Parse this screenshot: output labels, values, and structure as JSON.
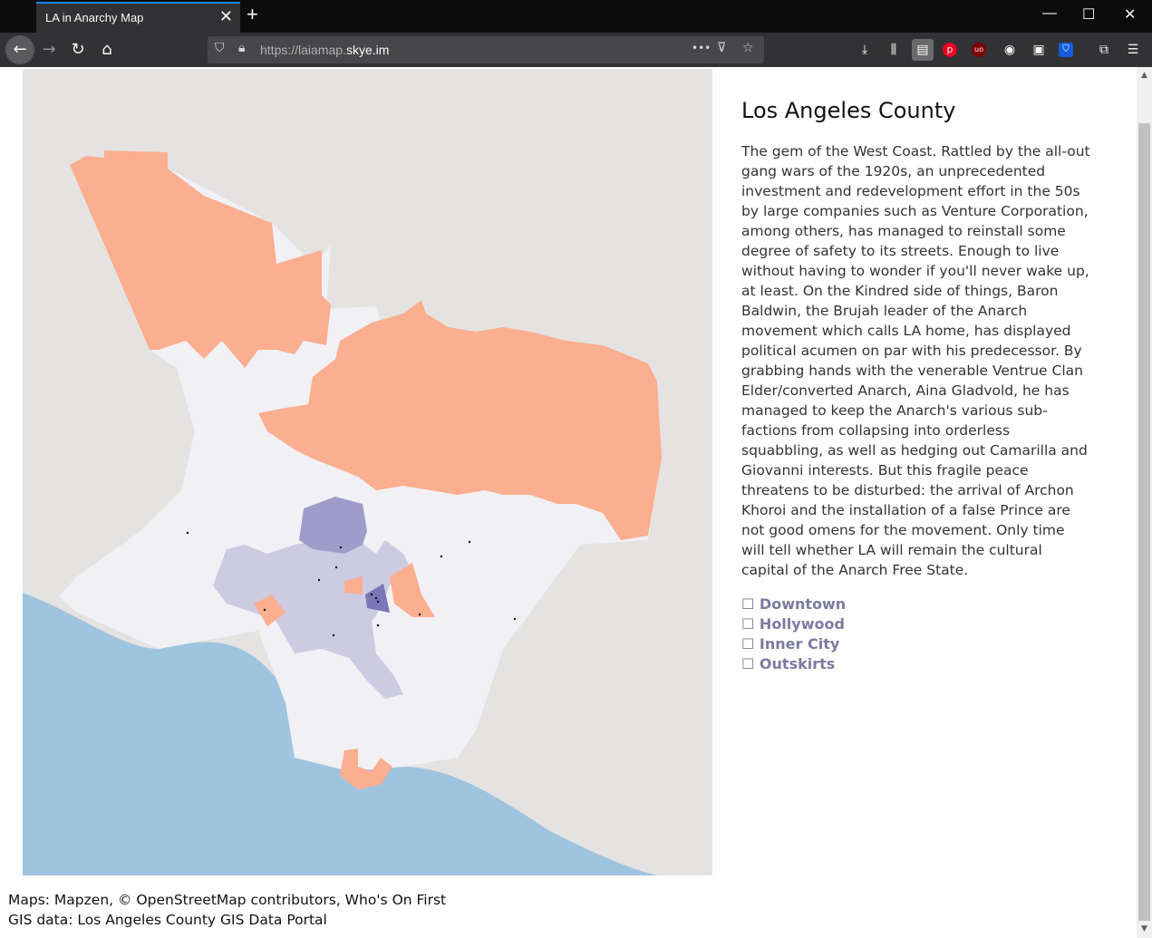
{
  "browser": {
    "tab_title": "LA in Anarchy Map",
    "new_tab_symbol": "+",
    "url_prefix": "https://laiamap.",
    "url_domain": "skye.im",
    "page_actions_symbol": "•••"
  },
  "county": {
    "title": "Los Angeles County",
    "description": "The gem of the West Coast. Rattled by the all-out gang wars of the 1920s, an unprecedented investment and redevelopment effort in the 50s by large companies such as Venture Corporation, among others, has managed to reinstall some degree of safety to its streets. Enough to live without having to wonder if you'll never wake up, at least. On the Kindred side of things, Baron Baldwin, the Brujah leader of the Anarch movement which calls LA home, has displayed political acumen on par with his predecessor. By grabbing hands with the venerable Ventrue Clan Elder/converted Anarch, Aina Gladvold, he has managed to keep the Anarch's various sub-factions from collapsing into orderless squabbling, as well as hedging out Camarilla and Giovanni interests. But this fragile peace threatens to be disturbed: the arrival of Archon Khoroi and the installation of a false Prince are not good omens for the movement. Only time will tell whether LA will remain the cultural capital of the Anarch Free State."
  },
  "regions": [
    {
      "label": "Downtown"
    },
    {
      "label": "Hollywood"
    },
    {
      "label": "Inner City"
    },
    {
      "label": "Outskirts"
    }
  ],
  "checkbox_symbol": "☐",
  "credits": {
    "maps": "Maps: Mapzen, © OpenStreetMap contributors, Who's On First",
    "gis": "GIS data: Los Angeles County GIS Data Portal"
  },
  "colors": {
    "land": "#e4e3e1",
    "water": "#9fc4df",
    "county": "#f1f0f5",
    "outskirts_orange": "#fbae90",
    "inner_city": "#cdcbe2",
    "hollywood": "#9f9ccb",
    "downtown": "#7b76b5",
    "link": "#7c7aa0"
  }
}
